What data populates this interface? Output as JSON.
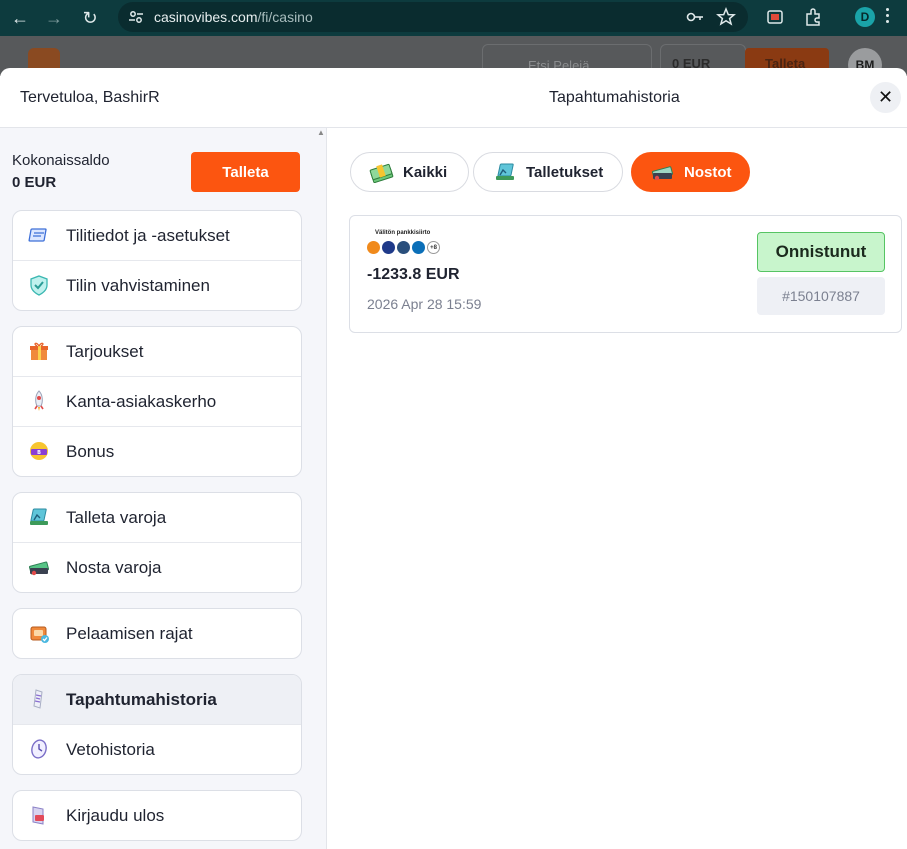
{
  "browser": {
    "url_domain": "casinovibes.com",
    "url_path": "/fi/casino",
    "profile_initial": "D"
  },
  "site_header": {
    "search_placeholder": "Etsi Pelejä",
    "balance": "0 EUR",
    "deposit_label": "Talleta",
    "avatar_initials": "BM"
  },
  "modal": {
    "welcome": "Tervetuloa, BashirR",
    "title": "Tapahtumahistoria",
    "close_symbol": "✕"
  },
  "sidebar": {
    "balance_label": "Kokonaissaldo",
    "balance_value": "0 EUR",
    "deposit_button": "Talleta",
    "groups": [
      {
        "items": [
          {
            "label": "Tilitiedot ja -asetukset",
            "icon": "account-settings-icon"
          },
          {
            "label": "Tilin vahvistaminen",
            "icon": "verification-shield-icon"
          }
        ]
      },
      {
        "items": [
          {
            "label": "Tarjoukset",
            "icon": "gift-icon"
          },
          {
            "label": "Kanta-asiakaskerho",
            "icon": "rocket-icon"
          },
          {
            "label": "Bonus",
            "icon": "bonus-icon"
          }
        ]
      },
      {
        "items": [
          {
            "label": "Talleta varoja",
            "icon": "deposit-funds-icon"
          },
          {
            "label": "Nosta varoja",
            "icon": "withdraw-funds-icon"
          }
        ]
      },
      {
        "items": [
          {
            "label": "Pelaamisen rajat",
            "icon": "gambling-limits-icon"
          }
        ]
      },
      {
        "items": [
          {
            "label": "Tapahtumahistoria",
            "icon": "transaction-history-icon",
            "active": true
          },
          {
            "label": "Vetohistoria",
            "icon": "bet-history-icon"
          }
        ]
      },
      {
        "items": [
          {
            "label": "Kirjaudu ulos",
            "icon": "logout-icon"
          }
        ]
      }
    ]
  },
  "filters": [
    {
      "label": "Kaikki",
      "active": false
    },
    {
      "label": "Talletukset",
      "active": false
    },
    {
      "label": "Nostot",
      "active": true
    }
  ],
  "transaction": {
    "method_caption": "Välitön pankkisiirto",
    "more_methods": "+8",
    "amount": "-1233.8 EUR",
    "date": "2026 Apr 28 15:59",
    "status": "Onnistunut",
    "id": "#150107887"
  },
  "colors": {
    "accent": "#fc5510",
    "success_bg": "#c8f5cc",
    "success_border": "#56c463",
    "browser_bar": "#0d3b3e"
  }
}
